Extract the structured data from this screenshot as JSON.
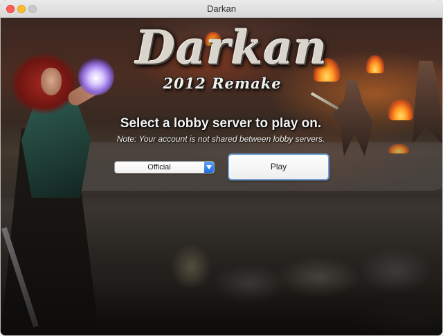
{
  "window": {
    "title": "Darkan"
  },
  "logo": {
    "main": "Darkan",
    "subtitle": "2012 Remake"
  },
  "content": {
    "prompt": "Select a lobby server to play on.",
    "note": "Note: Your account is not shared between lobby servers."
  },
  "server_select": {
    "selected": "Official"
  },
  "play_button": {
    "label": "Play"
  },
  "colors": {
    "close": "#fe5f57",
    "minimize": "#febc2e",
    "zoom_disabled": "#c9c9c9",
    "select_accent": "#1f6fe0",
    "button_focus_ring": "#6f9fd6"
  },
  "icons": {
    "dropdown": "chevron-down-icon"
  }
}
